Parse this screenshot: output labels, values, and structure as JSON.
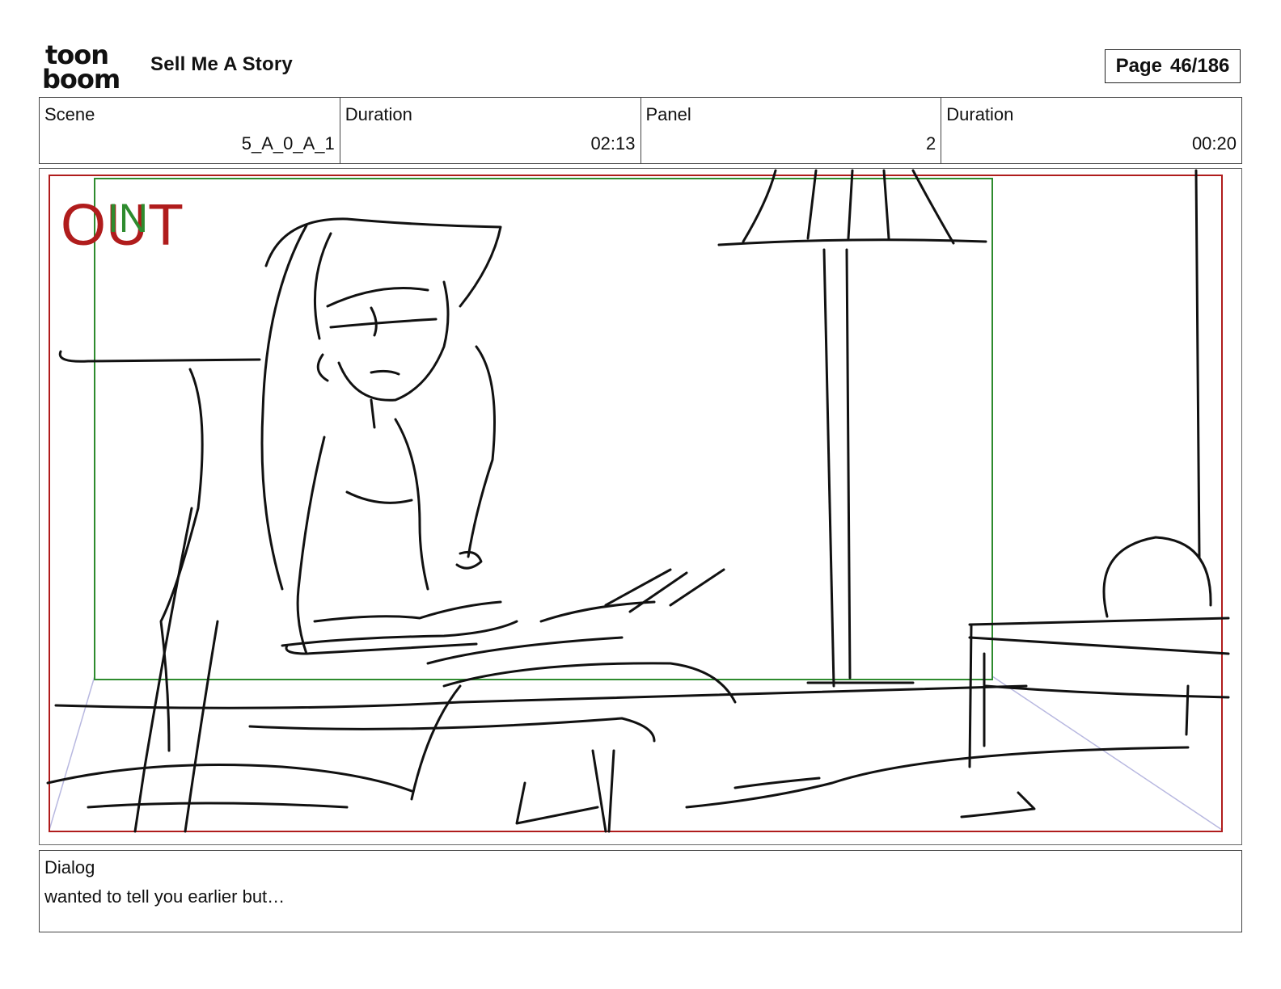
{
  "header": {
    "logo_text_top": "toon",
    "logo_text_bottom": "boom",
    "project_title": "Sell Me A Story",
    "page_label": "Page",
    "page_number": "46/186"
  },
  "info": {
    "scene_label": "Scene",
    "scene_value": "5_A_0_A_1",
    "scene_duration_label": "Duration",
    "scene_duration_value": "02:13",
    "panel_label": "Panel",
    "panel_value": "2",
    "panel_duration_label": "Duration",
    "panel_duration_value": "00:20"
  },
  "panel": {
    "out_marker": "OUT",
    "in_marker": "IN",
    "colors": {
      "out_frame": "#b01c1c",
      "in_frame": "#2e8b2e",
      "perspective": "#b8b8e0",
      "ink": "#111111"
    }
  },
  "dialog": {
    "label": "Dialog",
    "text": "wanted to tell you earlier but…"
  }
}
